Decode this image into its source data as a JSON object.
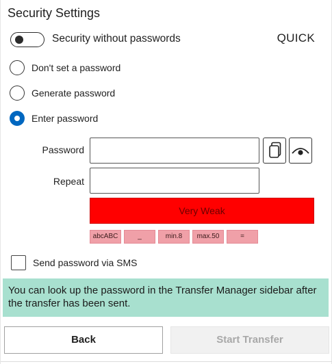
{
  "title": "Security Settings",
  "toggle": {
    "label": "Security without passwords",
    "on": false
  },
  "quick_label": "QUICK",
  "radio_options": [
    {
      "label": "Don't set a password",
      "checked": false
    },
    {
      "label": "Generate password",
      "checked": false
    },
    {
      "label": "Enter password",
      "checked": true
    }
  ],
  "password": {
    "label": "Password",
    "value": ""
  },
  "repeat": {
    "label": "Repeat",
    "value": ""
  },
  "icons": {
    "copy": "copy-icon",
    "show": "eye-icon"
  },
  "strength": {
    "label": "Very Weak",
    "color": "#ff0000"
  },
  "requirements": [
    "abcABC",
    "_",
    "min.8",
    "max.50",
    "="
  ],
  "sms": {
    "label": "Send password via SMS",
    "checked": false
  },
  "info_text": "You can look up the password in the Transfer Manager sidebar after the transfer has been sent.",
  "buttons": {
    "back": "Back",
    "start": "Start Transfer"
  },
  "colors": {
    "accent": "#0067c0",
    "info_bg": "#a8e0cf",
    "chip_bg": "#f0a0a8"
  }
}
